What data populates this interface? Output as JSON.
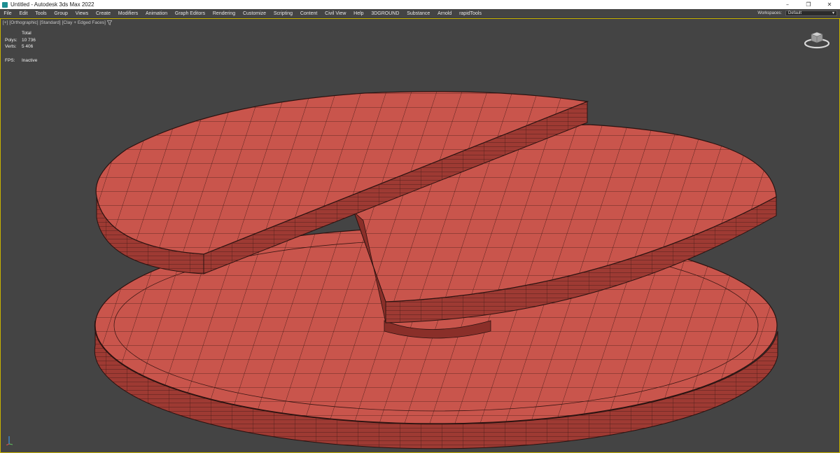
{
  "window": {
    "title": "Untitled - Autodesk 3ds Max 2022",
    "controls": [
      "–",
      "❐",
      "✕"
    ]
  },
  "menu": {
    "items": [
      "File",
      "Edit",
      "Tools",
      "Group",
      "Views",
      "Create",
      "Modifiers",
      "Animation",
      "Graph Editors",
      "Rendering",
      "Customize",
      "Scripting",
      "Content",
      "Civil View",
      "Help",
      "3DGROUND",
      "Substance",
      "Arnold",
      "rapidTools"
    ],
    "workspaces_label": "Workspaces:",
    "workspaces_value": "Default"
  },
  "viewport": {
    "labels": [
      "[+]",
      "[Orthographic]",
      "[Standard]",
      "[Clay + Edged Faces]"
    ],
    "filter_icon": "filter-icon",
    "stats": {
      "header": "Total",
      "polys_label": "Polys:",
      "polys_value": "10 736",
      "verts_label": "Verts:",
      "verts_value": "5 406",
      "fps_label": "FPS:",
      "fps_value": "Inactive"
    }
  },
  "colors": {
    "viewport_bg": "#444444",
    "clay": "#c9554c",
    "clay_side": "#9e3a33",
    "wire": "#2a1210",
    "active_border": "#c8b200"
  }
}
